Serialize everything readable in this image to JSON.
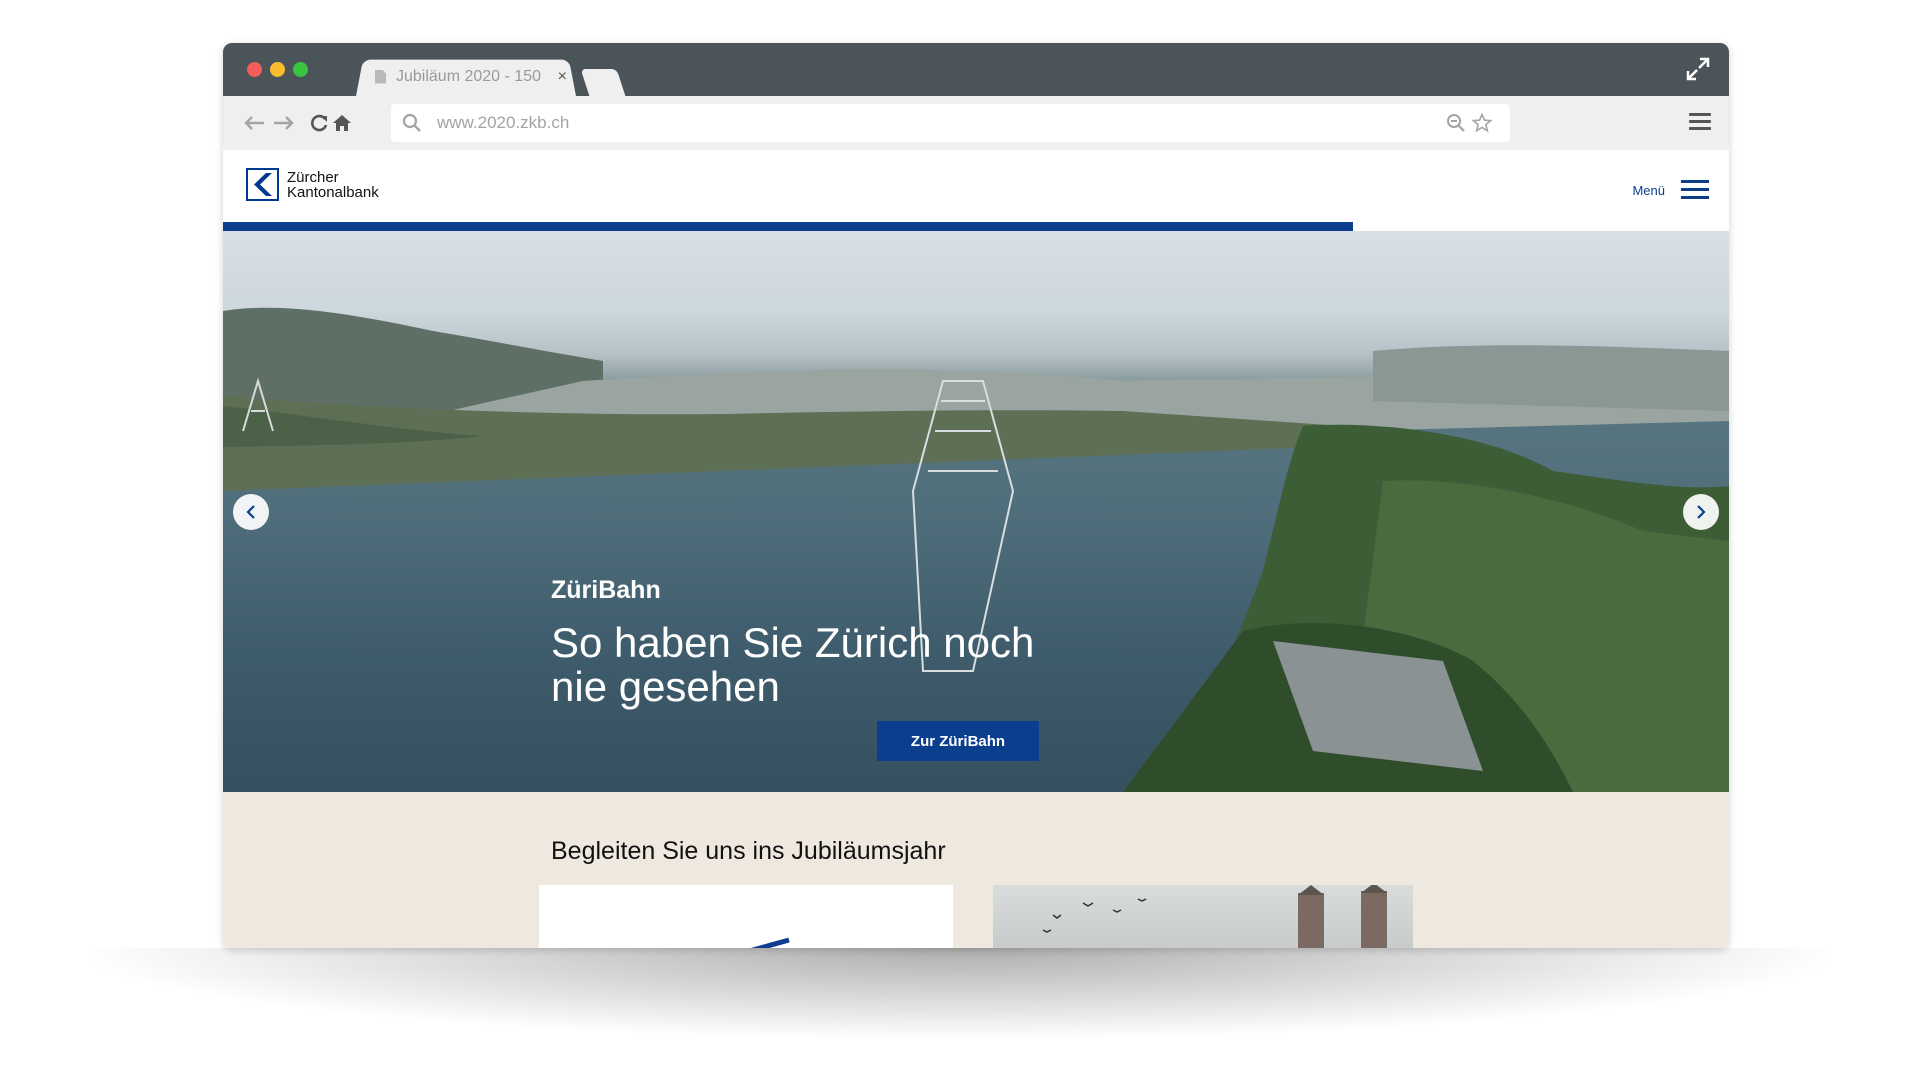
{
  "browser": {
    "tab_title": "Jubiläum 2020 - 150",
    "tab_close": "×",
    "url": "www.2020.zkb.ch"
  },
  "site": {
    "logo_line1": "Zürcher",
    "logo_line2": "Kantonalbank",
    "menu_label": "Menü",
    "progress_fraction": 0.75
  },
  "hero": {
    "kicker": "ZüriBahn",
    "title": "So haben Sie Zürich noch nie gesehen",
    "cta_label": "Zur ZüriBahn"
  },
  "section": {
    "title": "Begleiten Sie uns ins Jubiläumsjahr"
  },
  "colors": {
    "titlebar": "#4a5459",
    "brand_blue": "#0b3e8d",
    "section_bg": "#efe8df"
  },
  "icons": [
    "back-arrow-icon",
    "forward-arrow-icon",
    "reload-icon",
    "home-icon",
    "search-icon",
    "zoom-icon",
    "star-icon",
    "browser-menu-icon",
    "expand-icon",
    "chevron-left-icon",
    "chevron-right-icon",
    "hamburger-icon"
  ]
}
